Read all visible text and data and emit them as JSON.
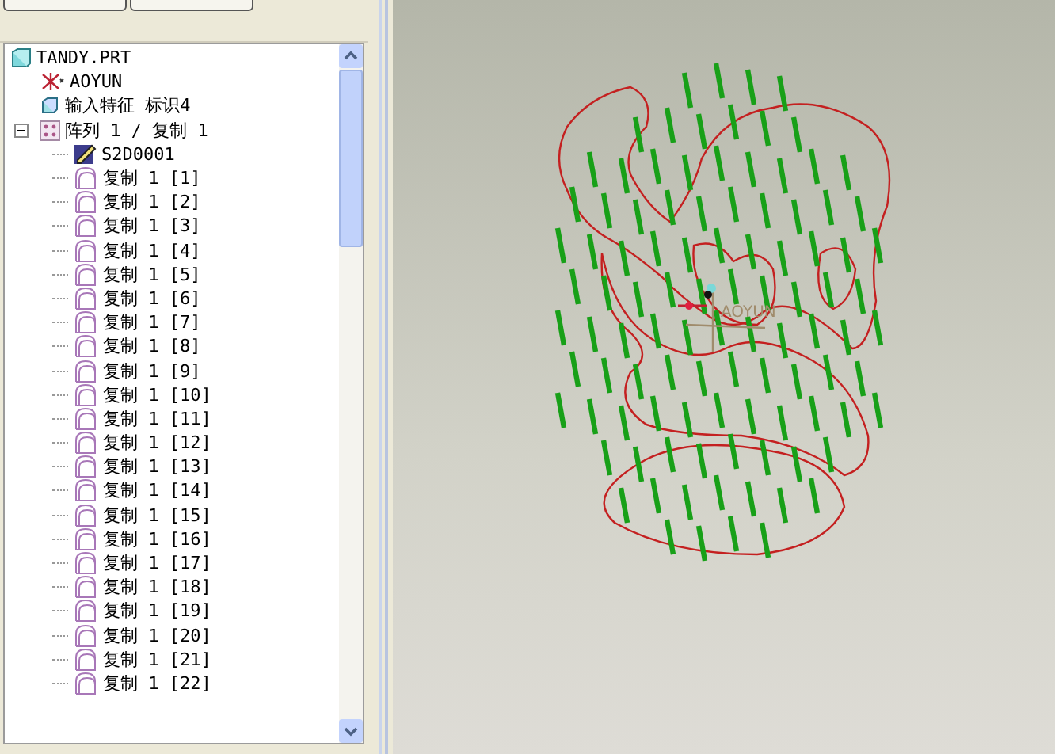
{
  "tree": {
    "label": "TANDY.PRT",
    "children": [
      {
        "kind": "csys",
        "label": "AOYUN"
      },
      {
        "kind": "import",
        "label": "输入特征 标识4"
      },
      {
        "kind": "pattern",
        "label": "阵列 1 / 复制 1",
        "expanded": true,
        "children": [
          {
            "kind": "sketch",
            "label": "S2D0001"
          },
          {
            "kind": "copy",
            "label": "复制 1 [1]"
          },
          {
            "kind": "copy",
            "label": "复制 1 [2]"
          },
          {
            "kind": "copy",
            "label": "复制 1 [3]"
          },
          {
            "kind": "copy",
            "label": "复制 1 [4]"
          },
          {
            "kind": "copy",
            "label": "复制 1 [5]"
          },
          {
            "kind": "copy",
            "label": "复制 1 [6]"
          },
          {
            "kind": "copy",
            "label": "复制 1 [7]"
          },
          {
            "kind": "copy",
            "label": "复制 1 [8]"
          },
          {
            "kind": "copy",
            "label": "复制 1 [9]"
          },
          {
            "kind": "copy",
            "label": "复制 1 [10]"
          },
          {
            "kind": "copy",
            "label": "复制 1 [11]"
          },
          {
            "kind": "copy",
            "label": "复制 1 [12]"
          },
          {
            "kind": "copy",
            "label": "复制 1 [13]"
          },
          {
            "kind": "copy",
            "label": "复制 1 [14]"
          },
          {
            "kind": "copy",
            "label": "复制 1 [15]"
          },
          {
            "kind": "copy",
            "label": "复制 1 [16]"
          },
          {
            "kind": "copy",
            "label": "复制 1 [17]"
          },
          {
            "kind": "copy",
            "label": "复制 1 [18]"
          },
          {
            "kind": "copy",
            "label": "复制 1 [19]"
          },
          {
            "kind": "copy",
            "label": "复制 1 [20]"
          },
          {
            "kind": "copy",
            "label": "复制 1 [21]"
          },
          {
            "kind": "copy",
            "label": "复制 1 [22]"
          }
        ]
      }
    ]
  },
  "canvas": {
    "csys_label": "AOYUN"
  }
}
